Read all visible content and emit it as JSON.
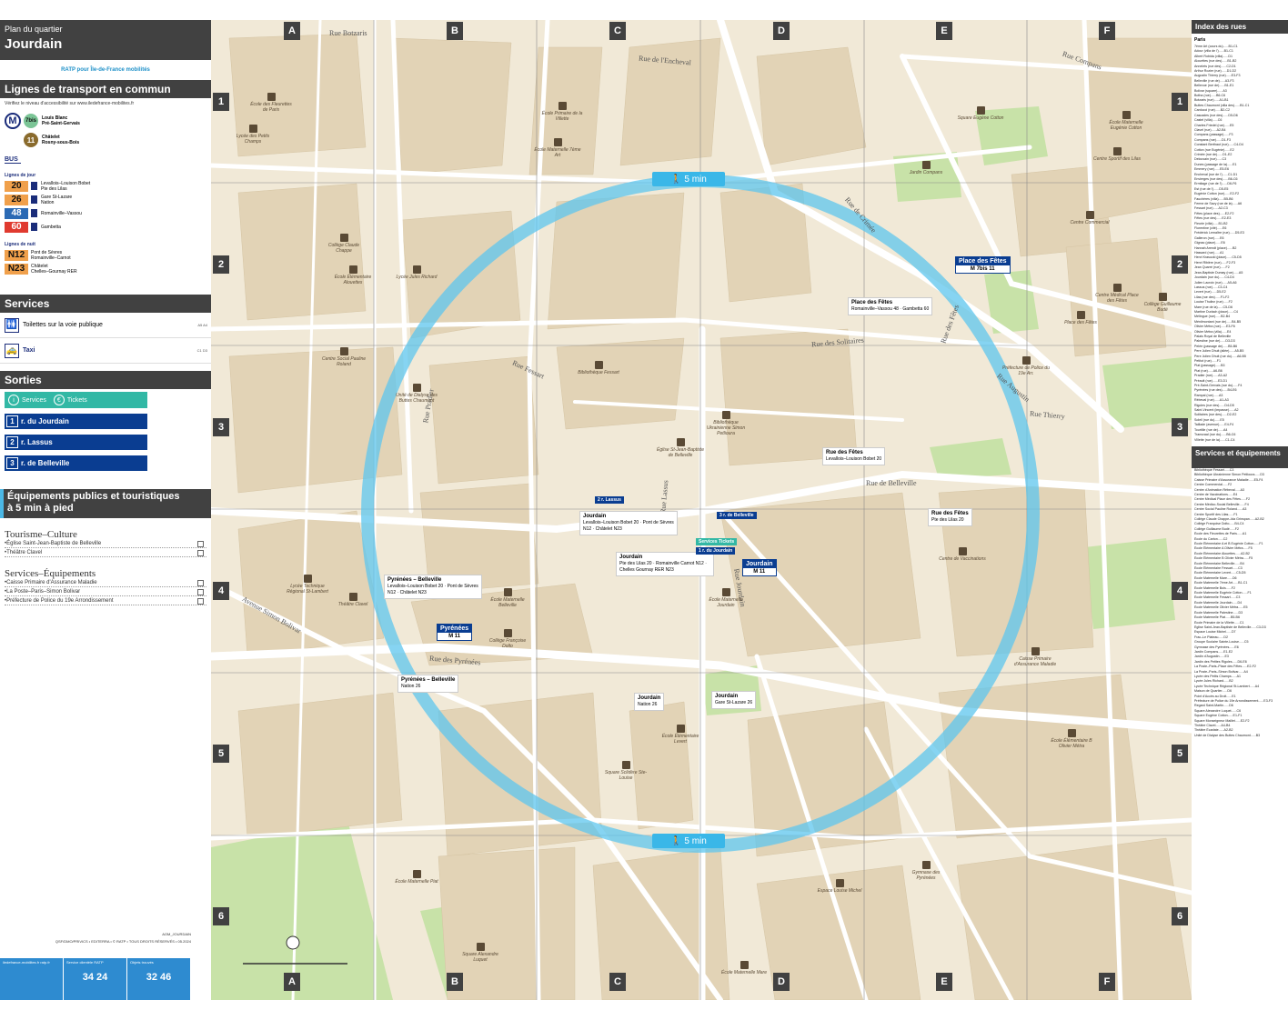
{
  "header": {
    "sub": "Plan du quartier",
    "title": "Jourdain",
    "logo_text": "RATP pour Île-de-France mobilités"
  },
  "transport": {
    "section_title": "Lignes de transport en commun",
    "note": "Vérifiez le niveau d'accessibilité sur www.iledefrance-mobilites.fr",
    "metro": [
      {
        "line": "7bis",
        "color": "#7bc596",
        "desc1": "Louis Blanc",
        "desc2": "Pré-Saint-Gervais"
      },
      {
        "line": "11",
        "color": "#8a6b2d",
        "desc1": "Châtelet",
        "desc2": "Rosny-sous-Bois"
      }
    ],
    "bus_label": "BUS",
    "day_label": "Lignes de jour",
    "night_label": "Lignes de nuit",
    "day_buses": [
      {
        "num": "20",
        "color": "#f0a04b",
        "dark": false,
        "desc1": "Levallois–Louison Bobet",
        "desc2": "Pte des Lilas"
      },
      {
        "num": "26",
        "color": "#f0a04b",
        "dark": false,
        "desc1": "Gare St-Lazare",
        "desc2": "Nation"
      },
      {
        "num": "48",
        "color": "#2b6ab4",
        "dark": true,
        "desc1": "Romainville–Vassou",
        "desc2": ""
      },
      {
        "num": "60",
        "color": "#e03a2f",
        "dark": true,
        "desc1": "Gambetta",
        "desc2": ""
      }
    ],
    "night_buses": [
      {
        "num": "N12",
        "color": "#f0a04b",
        "desc1": "Pont de Sèvres",
        "desc2": "Romainville–Carnot"
      },
      {
        "num": "N23",
        "color": "#f0a04b",
        "desc1": "Châtelet",
        "desc2": "Chelles–Gournay RER"
      }
    ]
  },
  "services": {
    "title": "Services",
    "items": [
      {
        "label": "Toilettes sur la voie publique",
        "ref": "A5 A4"
      },
      {
        "label": "Taxi",
        "ref": "C1 D3"
      }
    ]
  },
  "exits": {
    "title": "Sorties",
    "services_label": "Services",
    "tickets_label": "Tickets",
    "items": [
      {
        "num": "1",
        "label": "r. du Jourdain"
      },
      {
        "num": "2",
        "label": "r. Lassus"
      },
      {
        "num": "3",
        "label": "r. de Belleville"
      }
    ]
  },
  "equipment": {
    "title1": "Équipements publics et touristiques",
    "title2": "à 5 min à pied",
    "tourism_title": "Tourisme–Culture",
    "tourism_items": [
      "•Église Saint-Jean-Baptiste de Belleville",
      "•Théâtre Clavel"
    ],
    "services_title": "Services–Équipements",
    "services_items": [
      "•Caisse Primaire d'Assurance Maladie",
      "•La Poste–Paris–Simon Bolivar",
      "•Préfecture de Police du 19e Arrondissement"
    ]
  },
  "footer": {
    "ref": "AOM_JOURDAIN",
    "copyright": "QSF/DMO/PRIVICS • EDITERRA • © RATP • TOUS DROITS RÉSERVÉS • 05.2024",
    "col1": "iledefrance-mobilites.fr ratp.fr",
    "col2": "Service clientèle RATP",
    "phone2": "34 24",
    "col3": "Objets trouvés",
    "phone3": "32 46"
  },
  "map": {
    "letters": [
      "A",
      "B",
      "C",
      "D",
      "E",
      "F"
    ],
    "numbers": [
      "1",
      "2",
      "3",
      "4",
      "5",
      "6"
    ],
    "walk_label": "5 min",
    "streets": [
      {
        "t": "Rue de Belleville",
        "c": "s1"
      },
      {
        "t": "Rue des Pyrénées",
        "c": "s2"
      },
      {
        "t": "Avenue Simon Bolivar",
        "c": "s3"
      },
      {
        "t": "Rue de Crimée",
        "c": "s4"
      },
      {
        "t": "Rue des Fêtes",
        "c": "s5"
      },
      {
        "t": "Rue Compans",
        "c": "s6"
      },
      {
        "t": "Rue Fessart",
        "c": "s7"
      },
      {
        "t": "Rue de l'Encheval",
        "c": "s8"
      },
      {
        "t": "Rue Botzaris",
        "c": "s9"
      },
      {
        "t": "Rue Thierry",
        "c": "s10"
      },
      {
        "t": "Rue Augustin",
        "c": "s11"
      },
      {
        "t": "Rue Pradier",
        "c": "s12"
      },
      {
        "t": "Rue Lassus",
        "c": "s13"
      },
      {
        "t": "Rue Jourdain",
        "c": "s14"
      },
      {
        "t": "Rue des Solitaires",
        "c": "s15"
      }
    ],
    "pois": [
      {
        "t": "École des Fleurettes de Paris",
        "c": "p1"
      },
      {
        "t": "Lycée des Petits Champs",
        "c": "p2"
      },
      {
        "t": "École Primaire de la Villette",
        "c": "p3"
      },
      {
        "t": "École Maternelle 7ème Art",
        "c": "p4"
      },
      {
        "t": "Square Eugène Cotton",
        "c": "p5"
      },
      {
        "t": "École Maternelle Eugénie Cotton",
        "c": "p6"
      },
      {
        "t": "Centre Sportif des Lilas",
        "c": "p7"
      },
      {
        "t": "Jardin Compans",
        "c": "p8"
      },
      {
        "t": "Collège Claude Chappe",
        "c": "p9"
      },
      {
        "t": "École Élémentaire Alouettes",
        "c": "p10"
      },
      {
        "t": "Lycée Jules Richard",
        "c": "p11"
      },
      {
        "t": "Bibliothèque Fessart",
        "c": "p12"
      },
      {
        "t": "Église St-Jean-Baptiste de Belleville",
        "c": "p13"
      },
      {
        "t": "Bibliothèque Ukrainienne Simon Petlioura",
        "c": "p14"
      },
      {
        "t": "Centre de Vaccinations",
        "c": "p15"
      },
      {
        "t": "Caisse Primaire d'Assurance Maladie",
        "c": "p16"
      },
      {
        "t": "Lycée Technique Régional St-Lambert",
        "c": "p17"
      },
      {
        "t": "Théâtre Clavel",
        "c": "p18"
      },
      {
        "t": "École Maternelle Belleville",
        "c": "p19"
      },
      {
        "t": "Collège Françoise Dolto",
        "c": "p20"
      },
      {
        "t": "École Maternelle Jourdain",
        "c": "p21"
      },
      {
        "t": "Square Sclidère Ste-Louise",
        "c": "p22"
      },
      {
        "t": "École Élémentaire Levert",
        "c": "p23"
      },
      {
        "t": "École Élémentaire B Olivier Métra",
        "c": "p24"
      },
      {
        "t": "Gymnase des Pyrénées",
        "c": "p25"
      },
      {
        "t": "Espace Louise Michel",
        "c": "p26"
      },
      {
        "t": "École Maternelle Mare",
        "c": "p27"
      },
      {
        "t": "Square Alexandre Luquet",
        "c": "p28"
      },
      {
        "t": "École Maternelle Piat",
        "c": "p29"
      },
      {
        "t": "Place des Fêtes",
        "c": "p30"
      },
      {
        "t": "Centre Médical Place des Fêtes",
        "c": "p31"
      },
      {
        "t": "Préfecture de Police du 19e Arr.",
        "c": "p32"
      },
      {
        "t": "Collège Guillaume Budé",
        "c": "p33"
      },
      {
        "t": "Centre Social Pauline Roland",
        "c": "p34"
      },
      {
        "t": "Unité de Dialyse des Buttes Chaumont",
        "c": "p35"
      },
      {
        "t": "Centre Commercial",
        "c": "p36"
      }
    ],
    "stops": [
      {
        "name": "Jourdain",
        "lines": "Levallois–Louison Bobet 20 · Pont de Sèvres N12 · Châtelet N23",
        "c": "k1"
      },
      {
        "name": "Jourdain",
        "lines": "Pte des Lilas 20 · Romainville Carnot N12 · Chelles Gournay RER N23",
        "c": "k2"
      },
      {
        "name": "Pyrénées – Belleville",
        "lines": "Levallois–Louison Bobet 20 · Pont de Sèvres N12 · Châtelet N23",
        "c": "k3"
      },
      {
        "name": "Pyrénées – Belleville",
        "lines": "Nation 26",
        "c": "k4"
      },
      {
        "name": "Jourdain",
        "lines": "Nation 26",
        "c": "k5"
      },
      {
        "name": "Jourdain",
        "lines": "Gare St-Lazare 26",
        "c": "k6"
      },
      {
        "name": "Rue des Fêtes",
        "lines": "Levallois–Louison Bobet 20",
        "c": "k7"
      },
      {
        "name": "Rue des Fêtes",
        "lines": "Pte des Lilas 20",
        "c": "k8"
      },
      {
        "name": "Place des Fêtes",
        "lines": "Romainville–Vassou 48 · Gambetta 60",
        "c": "k9"
      }
    ],
    "stations": [
      {
        "name": "Jourdain",
        "lines": "M 11",
        "c": "st1"
      },
      {
        "name": "Pyrénées",
        "lines": "M 11",
        "c": "st2"
      },
      {
        "name": "Place des Fêtes",
        "lines": "M 7bis 11",
        "c": "st3"
      }
    ],
    "exit_tags": [
      {
        "t": "2 r. Lassus",
        "c": "e1"
      },
      {
        "t": "3 r. de Belleville",
        "c": "e2"
      },
      {
        "t": "1 r. du Jourdain",
        "c": "e3"
      },
      {
        "t": "Services  Tickets",
        "c": "e4"
      }
    ]
  },
  "index": {
    "streets_title": "Index des rues",
    "city": "Paris",
    "streets": [
      "7ème Art (cours du)......B1-C1",
      "Adour (villa de l')......B1-C1",
      "Albert Robida (villa)......D1",
      "Alouettes (rue des)......B1-B2",
      "Annelets (rue des)......C2-D1",
      "Arthur Rozier (rue)......D1-D2",
      "Augustin Thierry (rue)......E3-F3",
      "Belleville (rue de)......A3-F3",
      "Bellevue (rue de)......B1-E1",
      "Bolivar (square)......A3",
      "Botha (rue)......B6-C6",
      "Botzaris (rue)......A1-B1",
      "Buttes Chaumont (villa des)......B1-C1",
      "Carducci (rue)......B2-C2",
      "Cascades (rue des)......D5-D6",
      "Castel (villa)......C6",
      "Charles Friedel (rue)......E5",
      "Clavel (rue)......A2-B4",
      "Compans (passage)......F3",
      "Compans (rue)......D1-F3",
      "Constant Berthaut (rue)......C4-D4",
      "Cotton (rue Eugénie)......E2",
      "Crimée (rue de)......D1-E2",
      "Delouvain (rue)......C3",
      "Dunes (passage de la)......E1",
      "Emmery (rue)......E5-E6",
      "Encheval (rue de l')......C1-D1",
      "Envierges (rue des)......B6-C6",
      "Ermitage (rue de l')......D6-F6",
      "Est (rue de l')......D5-E5",
      "Eugénie Cotton (rue)......E2-F2",
      "Fauchères (villa)......B5-B6",
      "Ferme de Savy (rue de la)......A6",
      "Fessart (rue)......A2-C3",
      "Fêtes (place des)......E2-F2",
      "Fêtes (rue des)......E2-E3",
      "Fleurie (villa)......B1-B2",
      "Florentine (cité)......E6",
      "Frédérick Lemaître (rue)......D5-E3",
      "Galleron (rue)......E6",
      "Gignac (place)......E6",
      "Hannah Arendt (place)......B2",
      "Hassard (rue)......A1",
      "Henri Krasucki (place)......C5-D5",
      "Henri Ribière (rue)......F2-F3",
      "Jean Quarré (rue)......F2",
      "Jean-Baptiste Dumay (rue)......A5",
      "Jourdain (rue du)......C4-D4",
      "Julien Lacroix (rue)......A5-A6",
      "Lassus (rue)......C3-C4",
      "Levert (rue)......D5-E2",
      "Lilas (rue des)......F1-F2",
      "Louise Thuliez (rue)......F2",
      "Mare (rue de la)......C5-D6",
      "Martine Durlach (place)......C4",
      "Mélingue (rue)......B2-B4",
      "Ménilmontant (rue de)......B4-B5",
      "Olivier Métra (rue)......E3-F6",
      "Olivier Métra (villa)......E4",
      "Palais Royal de Belleville",
      "Palestine (rue de)......D3-D3",
      "Pelée (passage de)......B5-B6",
      "Pere Julien Dhuit (allée)......A5-B5",
      "Pere Julien Dhuit (rue du)......A6-B5",
      "Petitot (rue)......F1",
      "Piat (passage)......B3",
      "Piat (rue)......A6-B6",
      "Pradier (rue)......A3-A2",
      "Préault (rue)......E3-D1",
      "Pré-Saint-Gervais (rue du)......F4",
      "Pyrénées (rue des)......B4-E6",
      "Rampal (rue)......A3",
      "Rébeval (rue)......A1-A3",
      "Rigoles (rue des)......D4-D5",
      "Saint-Vincent (impasse)......A2",
      "Solitaires (rue des)......D2-E2",
      "Soleil (rue du)......E5",
      "Taillade (avenue)......E4-F4",
      "Tourtille (rue de)......A4",
      "Transvaal (rue du)......B6-C6",
      "Villette (rue de la)......C1-C4"
    ],
    "services_title": "Services et équipements",
    "services": [
      "Bibliothèque Fessart......C3",
      "Bibliothèque Ukrainienne Simon Petlioura......D3",
      "Caisse Primaire d'Assurance Maladie......E5-F4",
      "Centre Commercial......F2",
      "Centre d'Animation Rébeval......A3",
      "Centre de Vaccinations......E4",
      "Centre Médical Place des Fêtes......F2",
      "Centre Médico-Social Belleville......F4",
      "Centre Social Pauline Roland......A3",
      "Centre Sportif des Lilas......F1",
      "Collège Claude Chappe–Ida Grinspan......A2-B2",
      "Collège Françoise Dolto......B4-C4",
      "Collège Guillaume Budé......F2",
      "École des Fleurettes de Paris......A1",
      "École du Carton......C2",
      "École Élémentaire A et B Eugénie Cotton......F1",
      "École Élémentaire A Olivier Métra......F5",
      "École Élémentaire Alouettes......A2-B2",
      "École Élémentaire B Olivier Métra......F5",
      "École Élémentaire Belleville......B4",
      "École Élémentaire Fessart......C3",
      "École Élémentaire Levert......C5-D5",
      "École Maternelle Mare......D6",
      "École Maternelle 7ème Art......B1-C1",
      "École Maternelle Bois......F2",
      "École Maternelle Eugénie Cotton......F1",
      "École Maternelle Fessart......C3",
      "École Maternelle Jourdain......D4",
      "École Maternelle Olivier Métra......E5",
      "École Maternelle Palestine......D3",
      "École Maternelle Piat......B5-B6",
      "École Primaire de la Villette......C1",
      "Église Saint-Jean-Baptiste de Belleville......C3-D3",
      "Espace Louise Michel......D7",
      "Frac–Le Plateau......D2",
      "Groupe Scolaire Sainte-Louise......C5",
      "Gymnase des Pyrénées......E6",
      "Jardin Compans......E1-E2",
      "Jardin d'Augustin......E3",
      "Jardin des Petites Rigoles......D6-E6",
      "La Poste–Paris–Place des Fêtes......E2-F2",
      "La Poste–Paris–Simon Bolivar......A4",
      "Lycée des Petits Champs......A1",
      "Lycée Jules Richard......B2",
      "Lycée Technique Régional St-Lambert......A4",
      "Maison de Quartier......D6",
      "Point d'Accès au Droit......E1",
      "Préfecture de Police du 19e Arrondissement......E3-F3",
      "Regard Saint-Martin......D6",
      "Square Alexandre Luquet......C6",
      "Square Eugène Cotton......E1-F1",
      "Square Monseigneur Maillet......E2-F2",
      "Théâtre Clavel......A4-B4",
      "Théâtre Écarlate......A2-B2",
      "Unité de Dialyse des Buttes Chaumont......B3"
    ]
  }
}
